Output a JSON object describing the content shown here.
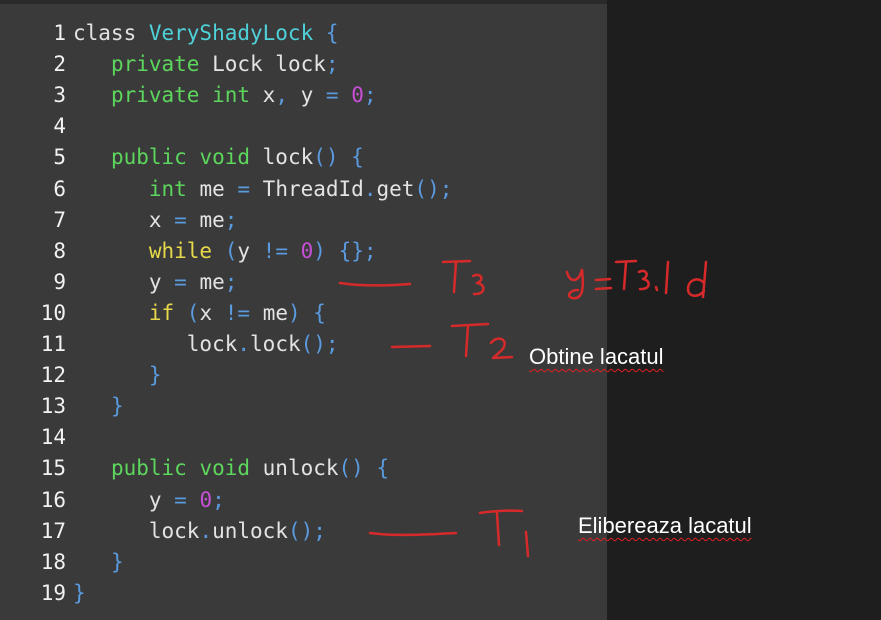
{
  "code_lines": [
    {
      "num": "1",
      "tokens": [
        {
          "t": "class ",
          "c": "plain"
        },
        {
          "t": "VeryShadyLock",
          "c": "kw-cyan"
        },
        {
          "t": " {",
          "c": "punc"
        }
      ]
    },
    {
      "num": "2",
      "tokens": [
        {
          "t": "   ",
          "c": "plain"
        },
        {
          "t": "private",
          "c": "kw-green"
        },
        {
          "t": " Lock lock",
          "c": "plain"
        },
        {
          "t": ";",
          "c": "punc"
        }
      ]
    },
    {
      "num": "3",
      "tokens": [
        {
          "t": "   ",
          "c": "plain"
        },
        {
          "t": "private int",
          "c": "kw-green"
        },
        {
          "t": " x",
          "c": "plain"
        },
        {
          "t": ",",
          "c": "punc"
        },
        {
          "t": " y ",
          "c": "plain"
        },
        {
          "t": "=",
          "c": "punc"
        },
        {
          "t": " ",
          "c": "plain"
        },
        {
          "t": "0",
          "c": "num"
        },
        {
          "t": ";",
          "c": "punc"
        }
      ]
    },
    {
      "num": "4",
      "tokens": []
    },
    {
      "num": "5",
      "tokens": [
        {
          "t": "   ",
          "c": "plain"
        },
        {
          "t": "public void",
          "c": "kw-green"
        },
        {
          "t": " lock",
          "c": "plain"
        },
        {
          "t": "() {",
          "c": "punc"
        }
      ]
    },
    {
      "num": "6",
      "tokens": [
        {
          "t": "      ",
          "c": "plain"
        },
        {
          "t": "int",
          "c": "kw-green"
        },
        {
          "t": " me ",
          "c": "plain"
        },
        {
          "t": "=",
          "c": "punc"
        },
        {
          "t": " ThreadId",
          "c": "plain"
        },
        {
          "t": ".",
          "c": "punc"
        },
        {
          "t": "get",
          "c": "plain"
        },
        {
          "t": "();",
          "c": "punc"
        }
      ]
    },
    {
      "num": "7",
      "tokens": [
        {
          "t": "      x ",
          "c": "plain"
        },
        {
          "t": "=",
          "c": "punc"
        },
        {
          "t": " me",
          "c": "plain"
        },
        {
          "t": ";",
          "c": "punc"
        }
      ]
    },
    {
      "num": "8",
      "tokens": [
        {
          "t": "      ",
          "c": "plain"
        },
        {
          "t": "while",
          "c": "kw-yellow"
        },
        {
          "t": " (",
          "c": "punc"
        },
        {
          "t": "y ",
          "c": "plain"
        },
        {
          "t": "!=",
          "c": "punc"
        },
        {
          "t": " ",
          "c": "plain"
        },
        {
          "t": "0",
          "c": "num"
        },
        {
          "t": ") {};",
          "c": "punc"
        }
      ]
    },
    {
      "num": "9",
      "tokens": [
        {
          "t": "      y ",
          "c": "plain"
        },
        {
          "t": "=",
          "c": "punc"
        },
        {
          "t": " me",
          "c": "plain"
        },
        {
          "t": ";",
          "c": "punc"
        }
      ]
    },
    {
      "num": "10",
      "tokens": [
        {
          "t": "      ",
          "c": "plain"
        },
        {
          "t": "if",
          "c": "kw-yellow"
        },
        {
          "t": " (",
          "c": "punc"
        },
        {
          "t": "x ",
          "c": "plain"
        },
        {
          "t": "!=",
          "c": "punc"
        },
        {
          "t": " me",
          "c": "plain"
        },
        {
          "t": ") {",
          "c": "punc"
        }
      ]
    },
    {
      "num": "11",
      "tokens": [
        {
          "t": "         lock",
          "c": "plain"
        },
        {
          "t": ".",
          "c": "punc"
        },
        {
          "t": "lock",
          "c": "plain"
        },
        {
          "t": "();",
          "c": "punc"
        }
      ]
    },
    {
      "num": "12",
      "tokens": [
        {
          "t": "      ",
          "c": "plain"
        },
        {
          "t": "}",
          "c": "punc"
        }
      ]
    },
    {
      "num": "13",
      "tokens": [
        {
          "t": "   ",
          "c": "plain"
        },
        {
          "t": "}",
          "c": "punc"
        }
      ]
    },
    {
      "num": "14",
      "tokens": []
    },
    {
      "num": "15",
      "tokens": [
        {
          "t": "   ",
          "c": "plain"
        },
        {
          "t": "public void",
          "c": "kw-green"
        },
        {
          "t": " unlock",
          "c": "plain"
        },
        {
          "t": "() {",
          "c": "punc"
        }
      ]
    },
    {
      "num": "16",
      "tokens": [
        {
          "t": "      y ",
          "c": "plain"
        },
        {
          "t": "=",
          "c": "punc"
        },
        {
          "t": " ",
          "c": "plain"
        },
        {
          "t": "0",
          "c": "num"
        },
        {
          "t": ";",
          "c": "punc"
        }
      ]
    },
    {
      "num": "17",
      "tokens": [
        {
          "t": "      lock",
          "c": "plain"
        },
        {
          "t": ".",
          "c": "punc"
        },
        {
          "t": "unlock",
          "c": "plain"
        },
        {
          "t": "();",
          "c": "punc"
        }
      ]
    },
    {
      "num": "18",
      "tokens": [
        {
          "t": "   ",
          "c": "plain"
        },
        {
          "t": "}",
          "c": "punc"
        }
      ]
    },
    {
      "num": "19",
      "tokens": [
        {
          "t": "}",
          "c": "punc"
        }
      ]
    }
  ],
  "annotations": {
    "obtine": "Obtine lacatul",
    "elibereaza": "Elibereaza lacatul"
  },
  "handwriting": {
    "t3": "T3",
    "t2": "T2",
    "t1": "T1",
    "y_eq": "y=T3.Id"
  },
  "colors": {
    "ink_red": "#d62a2a",
    "editor_bg": "#3a3a3a",
    "outer_bg": "#1e1e1e"
  }
}
